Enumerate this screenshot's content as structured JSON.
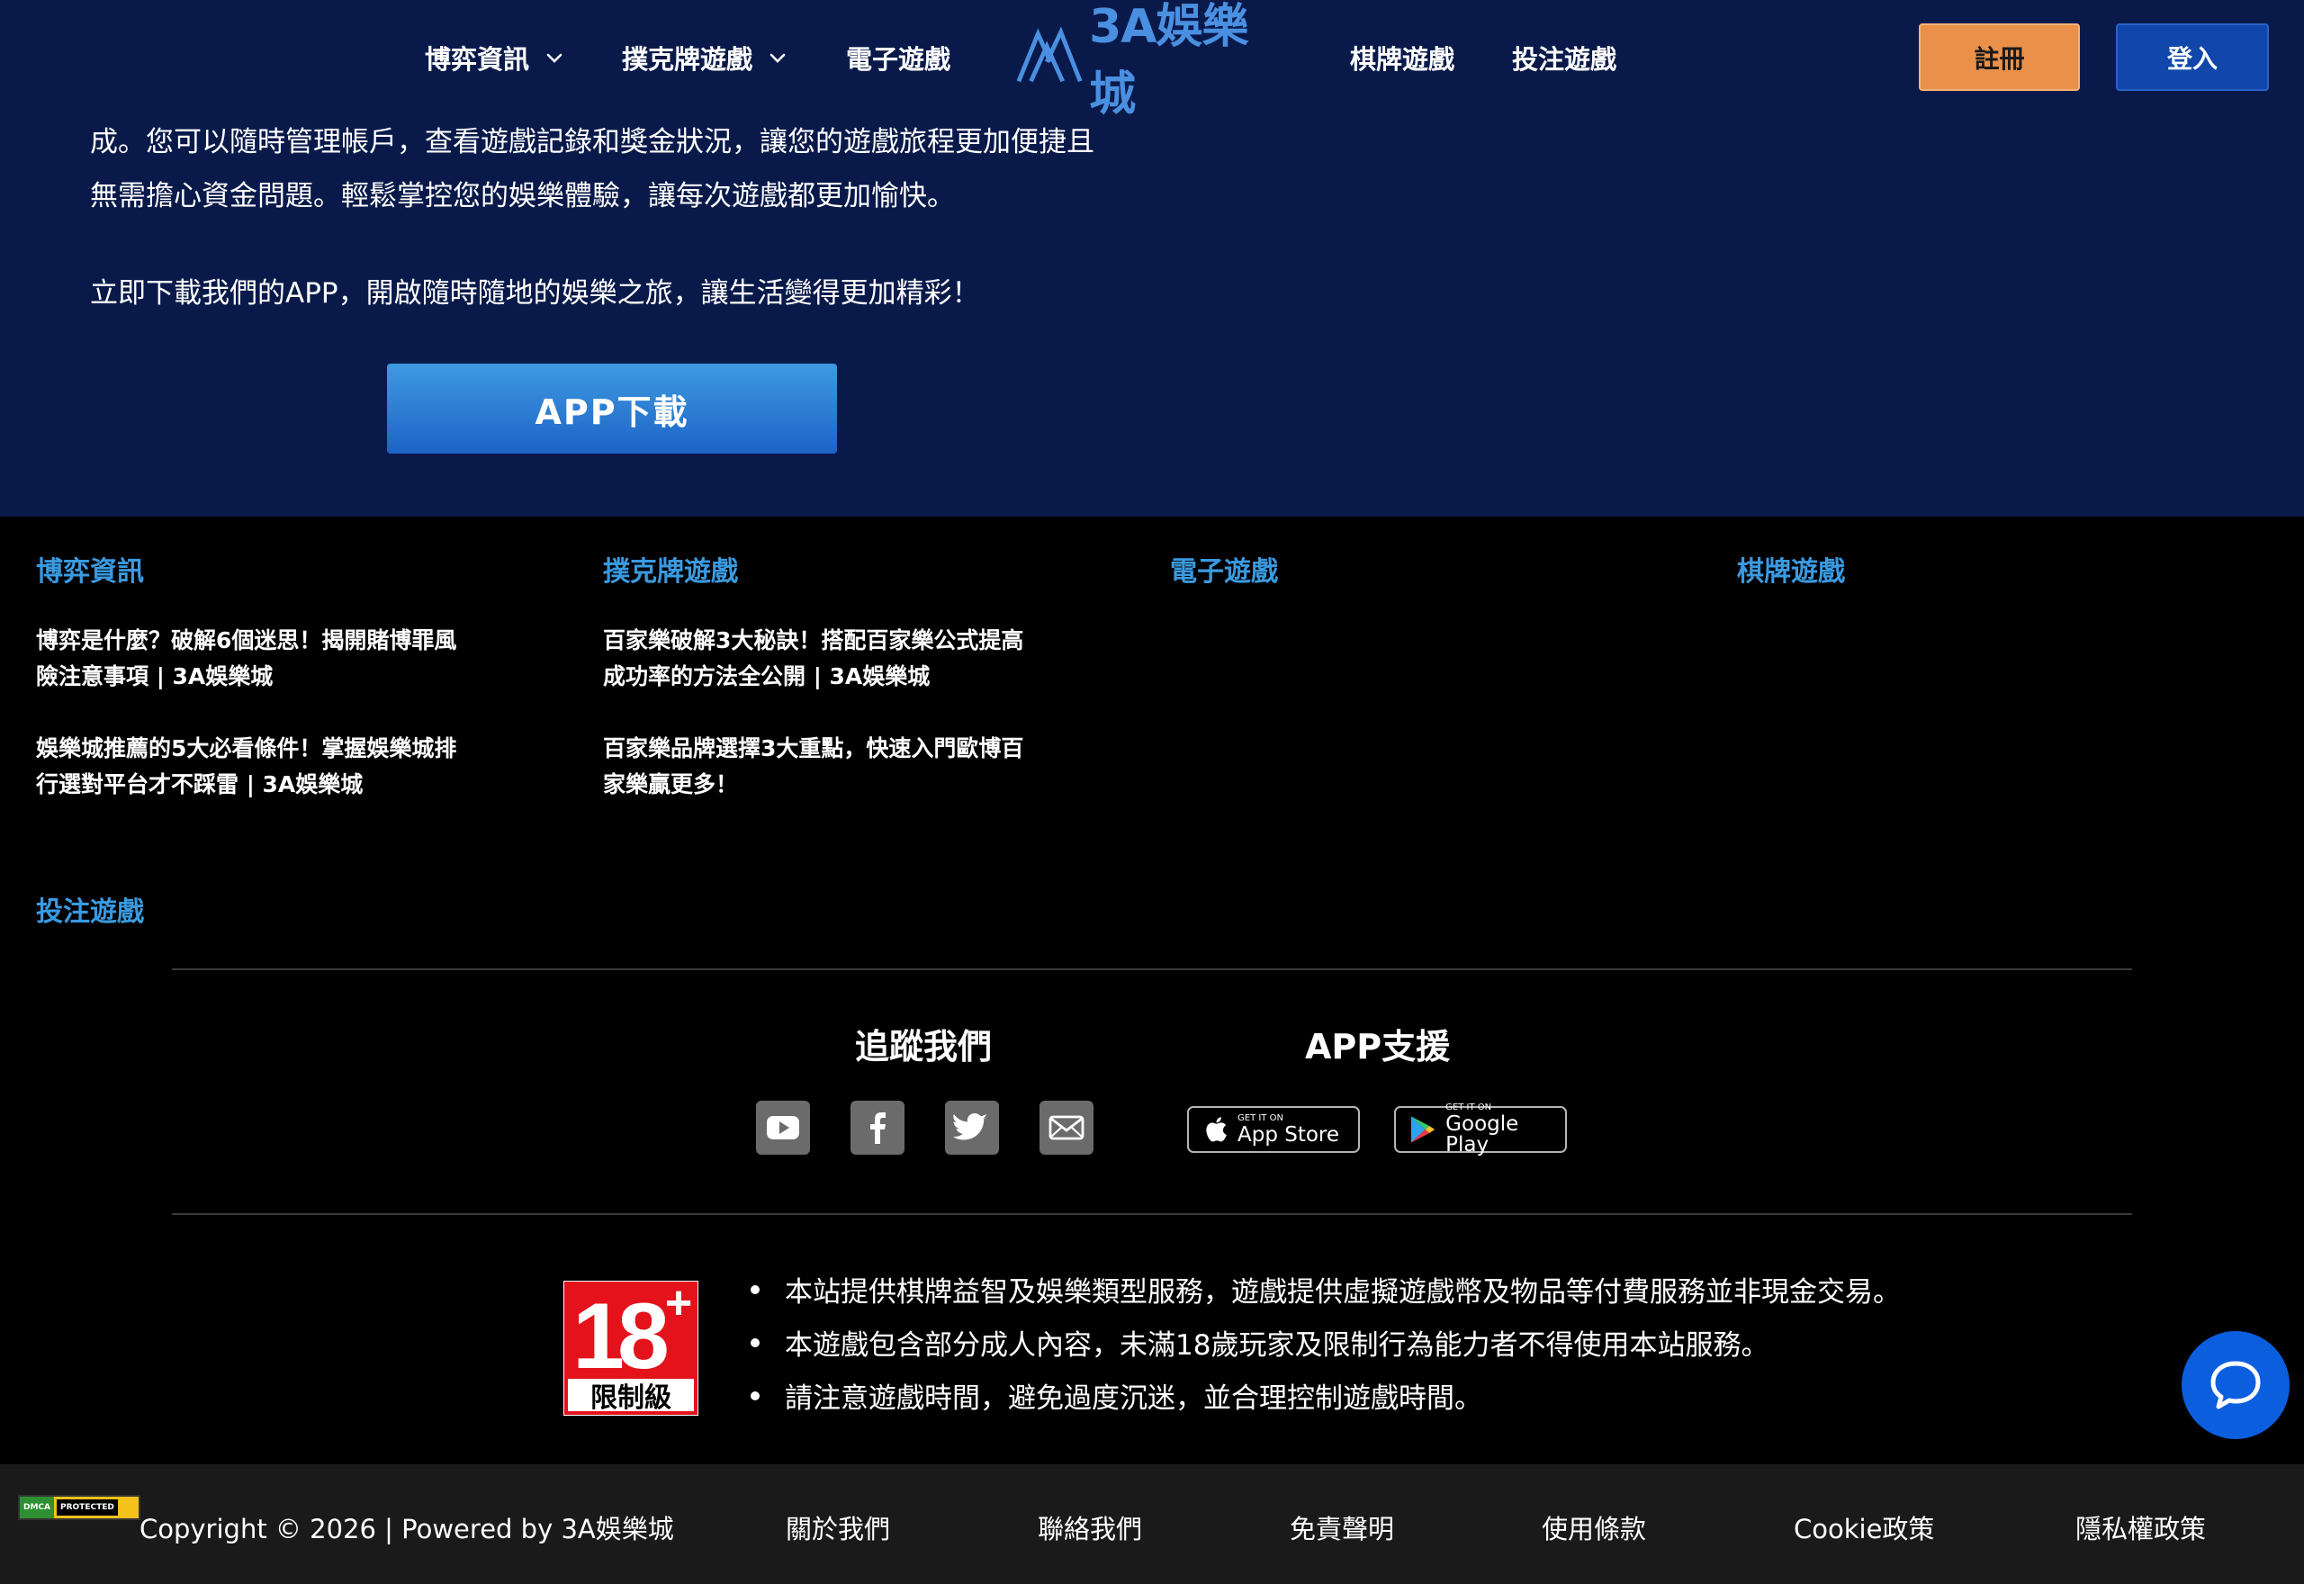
{
  "header": {
    "nav_left": [
      {
        "label": "博弈資訊",
        "has_dropdown": true
      },
      {
        "label": "撲克牌遊戲",
        "has_dropdown": true
      },
      {
        "label": "電子遊戲",
        "has_dropdown": false
      }
    ],
    "logo_text": "3A娛樂城",
    "nav_right": [
      {
        "label": "棋牌遊戲"
      },
      {
        "label": "投注遊戲"
      }
    ],
    "register_label": "註冊",
    "login_label": "登入"
  },
  "intro": {
    "lines": [
      "成。您可以隨時管理帳戶，查看遊戲記錄和獎金狀況，讓您的遊戲旅程更加便捷且",
      "無需擔心資金問題。輕鬆掌控您的娛樂體驗，讓每次遊戲都更加愉快。",
      "立即下載我們的APP，開啟隨時隨地的娛樂之旅，讓生活變得更加精彩！"
    ],
    "app_button_label": "APP下載"
  },
  "footer_columns": [
    {
      "title": "博弈資訊",
      "links": [
        [
          "博弈是什麼？破解6個迷思！揭開賭博罪風",
          "險注意事項 | 3A娛樂城"
        ],
        [
          "娛樂城推薦的5大必看條件！掌握娛樂城排",
          "行選對平台才不踩雷 | 3A娛樂城"
        ]
      ]
    },
    {
      "title": "撲克牌遊戲",
      "links": [
        [
          "百家樂破解3大秘訣！搭配百家樂公式提高",
          "成功率的方法全公開 | 3A娛樂城"
        ],
        [
          "百家樂品牌選擇3大重點，快速入門歐博百",
          "家樂贏更多！"
        ]
      ]
    },
    {
      "title": "電子遊戲",
      "links": []
    },
    {
      "title": "棋牌遊戲",
      "links": []
    },
    {
      "title": "投注遊戲",
      "links": []
    }
  ],
  "follow": {
    "title": "追蹤我們",
    "icons": [
      "youtube-icon",
      "facebook-icon",
      "twitter-icon",
      "email-icon"
    ]
  },
  "app_support": {
    "title": "APP支援",
    "app_store": {
      "small": "GET IT ON",
      "big": "App Store"
    },
    "google_play": {
      "small": "GET IT ON",
      "big": "Google Play"
    }
  },
  "age_badge": {
    "number": "18",
    "plus": "+",
    "label": "限制級"
  },
  "disclaimers": [
    "本站提供棋牌益智及娛樂類型服務，遊戲提供虛擬遊戲幣及物品等付費服務並非現金交易。",
    "本遊戲包含部分成人內容，未滿18歲玩家及限制行為能力者不得使用本站服務。",
    "請注意遊戲時間，避免過度沉迷，並合理控制遊戲時間。"
  ],
  "bottom_bar": {
    "dmca_left": "DMCA",
    "dmca_right": "PROTECTED",
    "copyright": "Copyright © 2026 | Powered by 3A娛樂城",
    "links": [
      "關於我們",
      "聯絡我們",
      "免責聲明",
      "使用條款",
      "Cookie政策",
      "隱私權政策"
    ]
  },
  "colors": {
    "header_bg": "#091a4a",
    "accent_blue": "#3a9ae0",
    "register_orange": "#e9914a",
    "login_blue": "#1147ab",
    "chat_blue": "#0b5ede"
  }
}
